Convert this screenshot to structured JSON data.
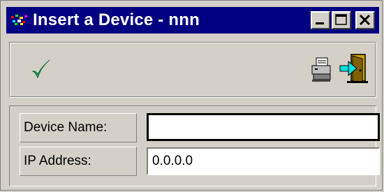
{
  "window": {
    "title": "Insert a Device - nnn",
    "controls": {
      "minimize": "minimize",
      "maximize": "maximize",
      "close": "close"
    }
  },
  "toolbar": {
    "buttons": [
      {
        "icon": "checkmark-icon",
        "action": "accept"
      },
      {
        "icon": "printer-icon",
        "action": "print"
      },
      {
        "icon": "exit-door-icon",
        "action": "exit"
      }
    ]
  },
  "form": {
    "device_name": {
      "label": "Device Name:",
      "value": ""
    },
    "ip_address": {
      "label": "IP Address:",
      "value": "0.0.0.0"
    }
  },
  "colors": {
    "titlebar": "#000080",
    "face": "#d4d0c8",
    "check": "#1fae57"
  }
}
